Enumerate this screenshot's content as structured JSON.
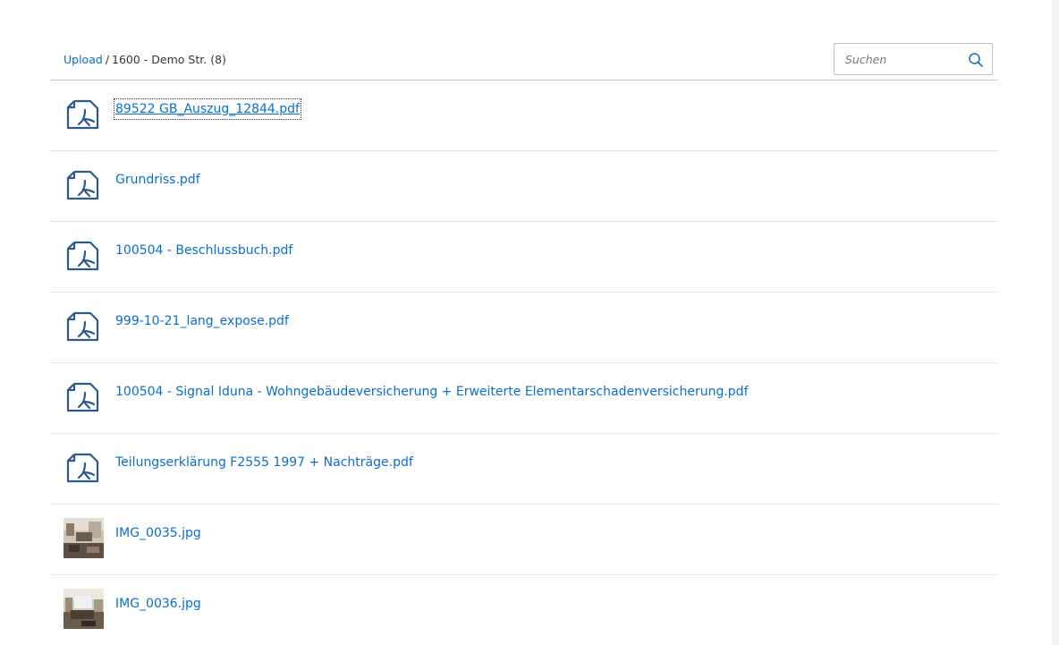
{
  "breadcrumb": {
    "link_label": "Upload",
    "separator": "/",
    "current_label": "1600 - Demo Str. (8)"
  },
  "search": {
    "placeholder": "Suchen",
    "value": "",
    "icon": "search-icon"
  },
  "files": [
    {
      "name": "89522 GB_Auszug_12844.pdf",
      "type": "pdf",
      "icon": "pdf-document-icon",
      "focused": true
    },
    {
      "name": "Grundriss.pdf",
      "type": "pdf",
      "icon": "pdf-document-icon"
    },
    {
      "name": "100504 - Beschlussbuch.pdf",
      "type": "pdf",
      "icon": "pdf-document-icon"
    },
    {
      "name": "999-10-21_lang_expose.pdf",
      "type": "pdf",
      "icon": "pdf-document-icon"
    },
    {
      "name": "100504 - Signal Iduna - Wohngebäudeversicherung + Erweiterte Elementarschadenversicherung.pdf",
      "type": "pdf",
      "icon": "pdf-document-icon"
    },
    {
      "name": "Teilungserklärung F2555 1997 + Nachträge.pdf",
      "type": "pdf",
      "icon": "pdf-document-icon"
    },
    {
      "name": "IMG_0035.jpg",
      "type": "image",
      "icon": "image-thumbnail"
    },
    {
      "name": "IMG_0036.jpg",
      "type": "image",
      "icon": "image-thumbnail"
    }
  ],
  "colors": {
    "link": "#0a6ed1",
    "icon": "#2d5a8a",
    "text": "#32363a",
    "divider": "#e5e5e5"
  }
}
